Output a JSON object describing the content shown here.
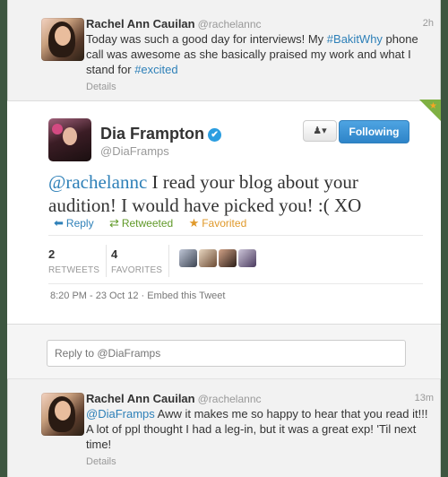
{
  "top_tweet": {
    "name": "Rachel Ann Cauilan",
    "handle": "@rachelannc",
    "time": "2h",
    "text_before": "Today was such a good day for interviews! My ",
    "hashtag1": "#BakitWhy",
    "text_middle": " phone call was awesome as she basically praised my work and what I stand for ",
    "hashtag2": "#excited",
    "details": "Details"
  },
  "main_tweet": {
    "name": "Dia Frampton",
    "verified_icon": "✔",
    "handle": "@DiaFramps",
    "user_menu_icon": "▾",
    "follow_label": "Following",
    "mention": "@rachelannc",
    "text": " I read your blog about your audition! I would have picked you! :( XO",
    "actions": {
      "reply": "Reply",
      "retweeted": "Retweeted",
      "favorited": "Favorited"
    },
    "retweets_count": "2",
    "retweets_label": "RETWEETS",
    "favorites_count": "4",
    "favorites_label": "FAVORITES",
    "timestamp": "8:20 PM - 23 Oct 12",
    "embed_label": "Embed this Tweet"
  },
  "reply_box": {
    "placeholder": "Reply to @DiaFramps"
  },
  "bottom_tweet": {
    "name": "Rachel Ann Cauilan",
    "handle": "@rachelannc",
    "time": "13m",
    "mention": "@DiaFramps",
    "text": " Aww it makes me so happy to hear that you read it!!! A lot of ppl thought I had a leg-in, but it was a great exp! 'Til next time!",
    "details": "Details"
  },
  "colors": {
    "link": "#2e80b8",
    "follow_button": "#2e84c8",
    "retweet": "#609928",
    "favorite": "#e0992a",
    "background": "#3d5640"
  }
}
